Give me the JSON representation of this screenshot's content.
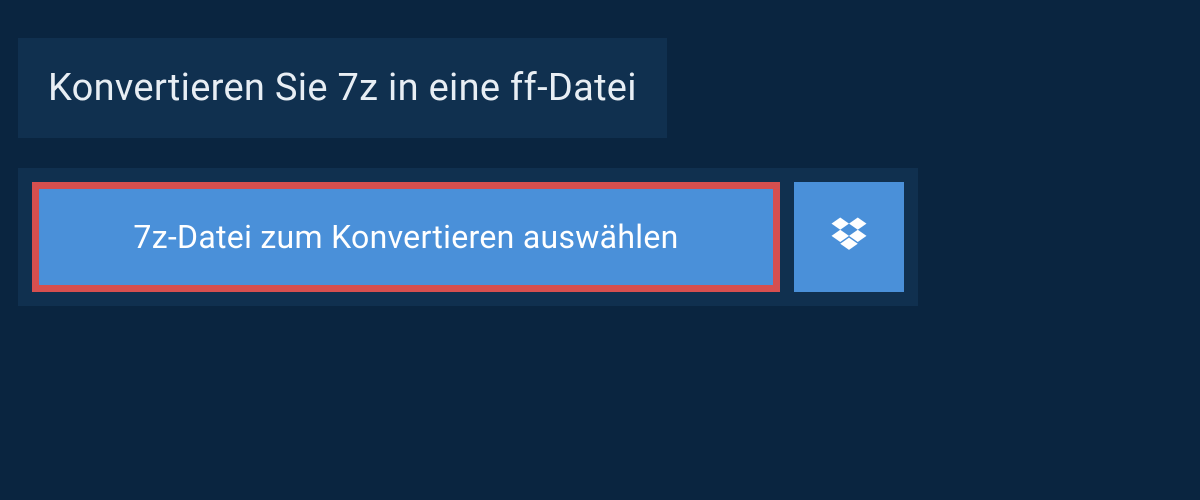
{
  "header": {
    "title": "Konvertieren Sie 7z in eine ff-Datei"
  },
  "upload": {
    "select_label": "7z-Datei zum Konvertieren auswählen",
    "dropbox_icon": "dropbox"
  }
}
